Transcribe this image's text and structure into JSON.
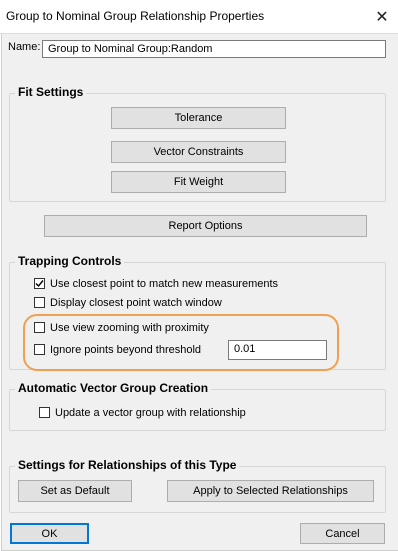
{
  "window": {
    "title": "Group to Nominal Group Relationship Properties",
    "close_glyph": "✕"
  },
  "name_field": {
    "label": "Name:",
    "value": "Group to Nominal Group:Random"
  },
  "fit_settings": {
    "title": "Fit Settings",
    "tolerance_label": "Tolerance",
    "vector_constraints_label": "Vector Constraints",
    "fit_weight_label": "Fit Weight"
  },
  "report_options_label": "Report Options",
  "trapping_controls": {
    "title": "Trapping Controls",
    "items": [
      {
        "label": "Use closest point to match new measurements",
        "checked": true
      },
      {
        "label": "Display closest point watch window",
        "checked": false
      },
      {
        "label": "Use view zooming with proximity",
        "checked": false
      },
      {
        "label": "Ignore points beyond threshold",
        "checked": false
      }
    ],
    "threshold_value": "0.01",
    "highlight_color": "#f0a050"
  },
  "automatic_vector": {
    "title": "Automatic Vector Group Creation",
    "item": {
      "label": "Update a vector group with relationship",
      "checked": false
    }
  },
  "relationship_settings": {
    "title": "Settings for Relationships of this Type",
    "set_default_label": "Set as Default",
    "apply_selected_label": "Apply to Selected Relationships"
  },
  "footer": {
    "ok_label": "OK",
    "cancel_label": "Cancel"
  },
  "colors": {
    "accent": "#0078d7",
    "dialog_bg": "#f0f0f0",
    "button_bg": "#e1e1e1"
  }
}
